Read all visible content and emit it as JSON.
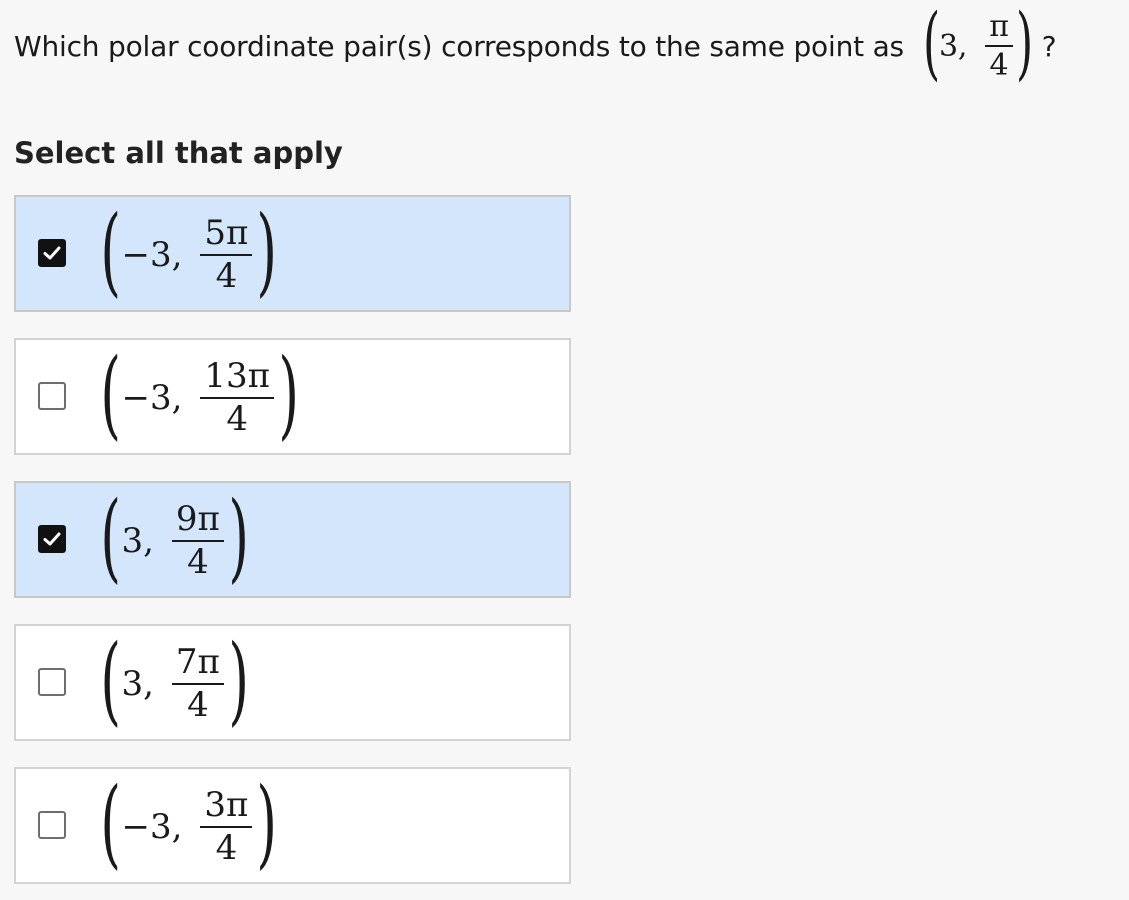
{
  "question": {
    "text": "Which polar coordinate pair(s) corresponds to the same point as",
    "r": "3,",
    "theta_num": "π",
    "theta_den": "4",
    "suffix": "?"
  },
  "instruction": "Select all that apply",
  "options": [
    {
      "r": "−3,",
      "num": "5π",
      "den": "4",
      "checked": true
    },
    {
      "r": "−3,",
      "num": "13π",
      "den": "4",
      "checked": false
    },
    {
      "r": "3,",
      "num": "9π",
      "den": "4",
      "checked": true
    },
    {
      "r": "3,",
      "num": "7π",
      "den": "4",
      "checked": false
    },
    {
      "r": "−3,",
      "num": "3π",
      "den": "4",
      "checked": false
    }
  ],
  "colors": {
    "selected_bg": "#d4e6fb",
    "checkbox_checked": "#111111",
    "border": "#d3d3d3"
  }
}
